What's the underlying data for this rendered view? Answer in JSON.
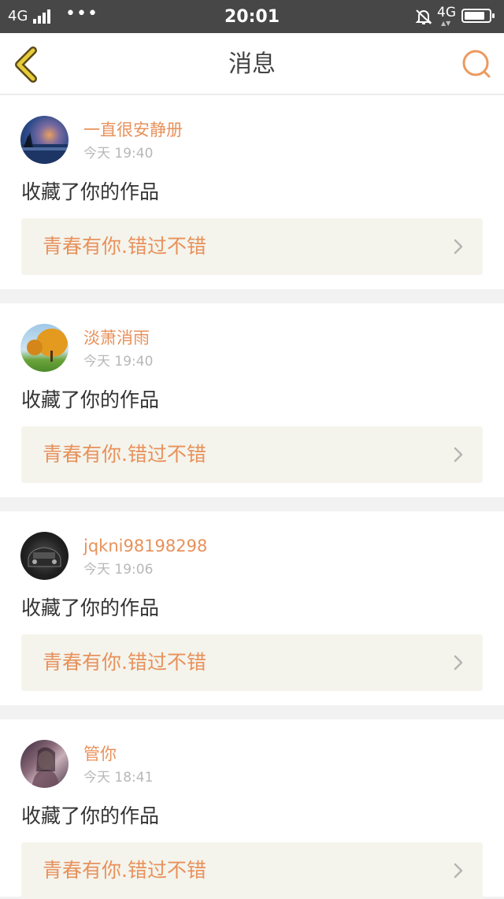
{
  "status_bar": {
    "network_left": "4G",
    "dots": "•••",
    "time": "20:01",
    "network_right": "4G"
  },
  "header": {
    "title": "消息",
    "back_icon": "back-chevron-icon",
    "search_icon": "search-icon"
  },
  "colors": {
    "accent": "#e8915b",
    "title": "#444444",
    "back_icon": "#e6cc3a",
    "work_box_bg": "#f4f4ec"
  },
  "messages": [
    {
      "username": "一直很安静册",
      "time": "今天 19:40",
      "action": "收藏了你的作品",
      "work_title": "青春有你.错过不错"
    },
    {
      "username": "淡萧消雨",
      "time": "今天 19:40",
      "action": "收藏了你的作品",
      "work_title": "青春有你.错过不错"
    },
    {
      "username": "jqkni98198298",
      "time": "今天 19:06",
      "action": "收藏了你的作品",
      "work_title": "青春有你.错过不错"
    },
    {
      "username": "管你",
      "time": "今天 18:41",
      "action": "收藏了你的作品",
      "work_title": "青春有你.错过不错"
    }
  ]
}
